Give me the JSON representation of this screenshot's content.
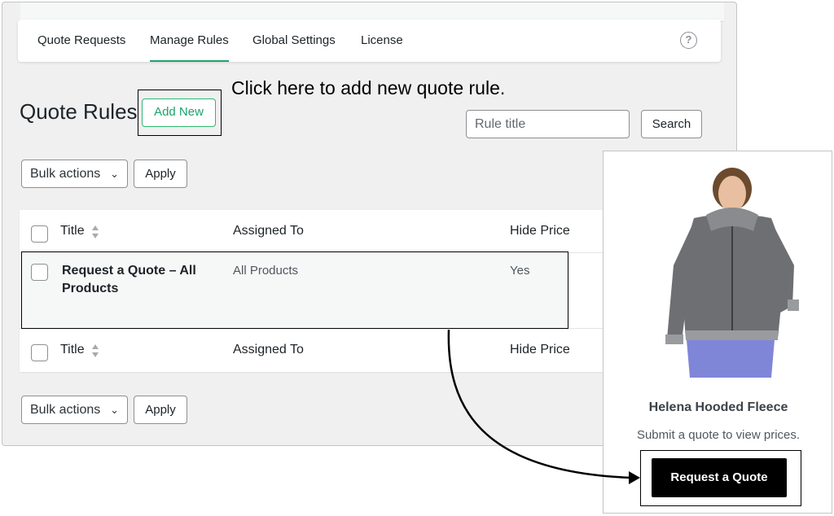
{
  "nav": {
    "tabs": [
      {
        "label": "Quote Requests",
        "active": false
      },
      {
        "label": "Manage Rules",
        "active": true
      },
      {
        "label": "Global Settings",
        "active": false
      },
      {
        "label": "License",
        "active": false
      }
    ],
    "help_icon": "question-circle-icon"
  },
  "header": {
    "title": "Quote Rules",
    "add_new_label": "Add New",
    "callout": "Click here to add new quote rule."
  },
  "search": {
    "placeholder": "Rule title",
    "button_label": "Search"
  },
  "bulk_top": {
    "select_value": "Bulk actions",
    "apply_label": "Apply"
  },
  "bulk_bottom": {
    "select_value": "Bulk actions",
    "apply_label": "Apply"
  },
  "table": {
    "columns": [
      "Title",
      "Assigned To",
      "Hide Price"
    ],
    "rows": [
      {
        "title": "Request a Quote – All Products",
        "assigned_to": "All Products",
        "hide_price": "Yes"
      }
    ]
  },
  "product": {
    "name": "Helena Hooded Fleece",
    "subtitle": "Submit a quote to view prices.",
    "button_label": "Request a Quote"
  },
  "colors": {
    "accent": "#1aa36b",
    "quote_button": "#000000",
    "page_bg": "#f0f0f1"
  }
}
